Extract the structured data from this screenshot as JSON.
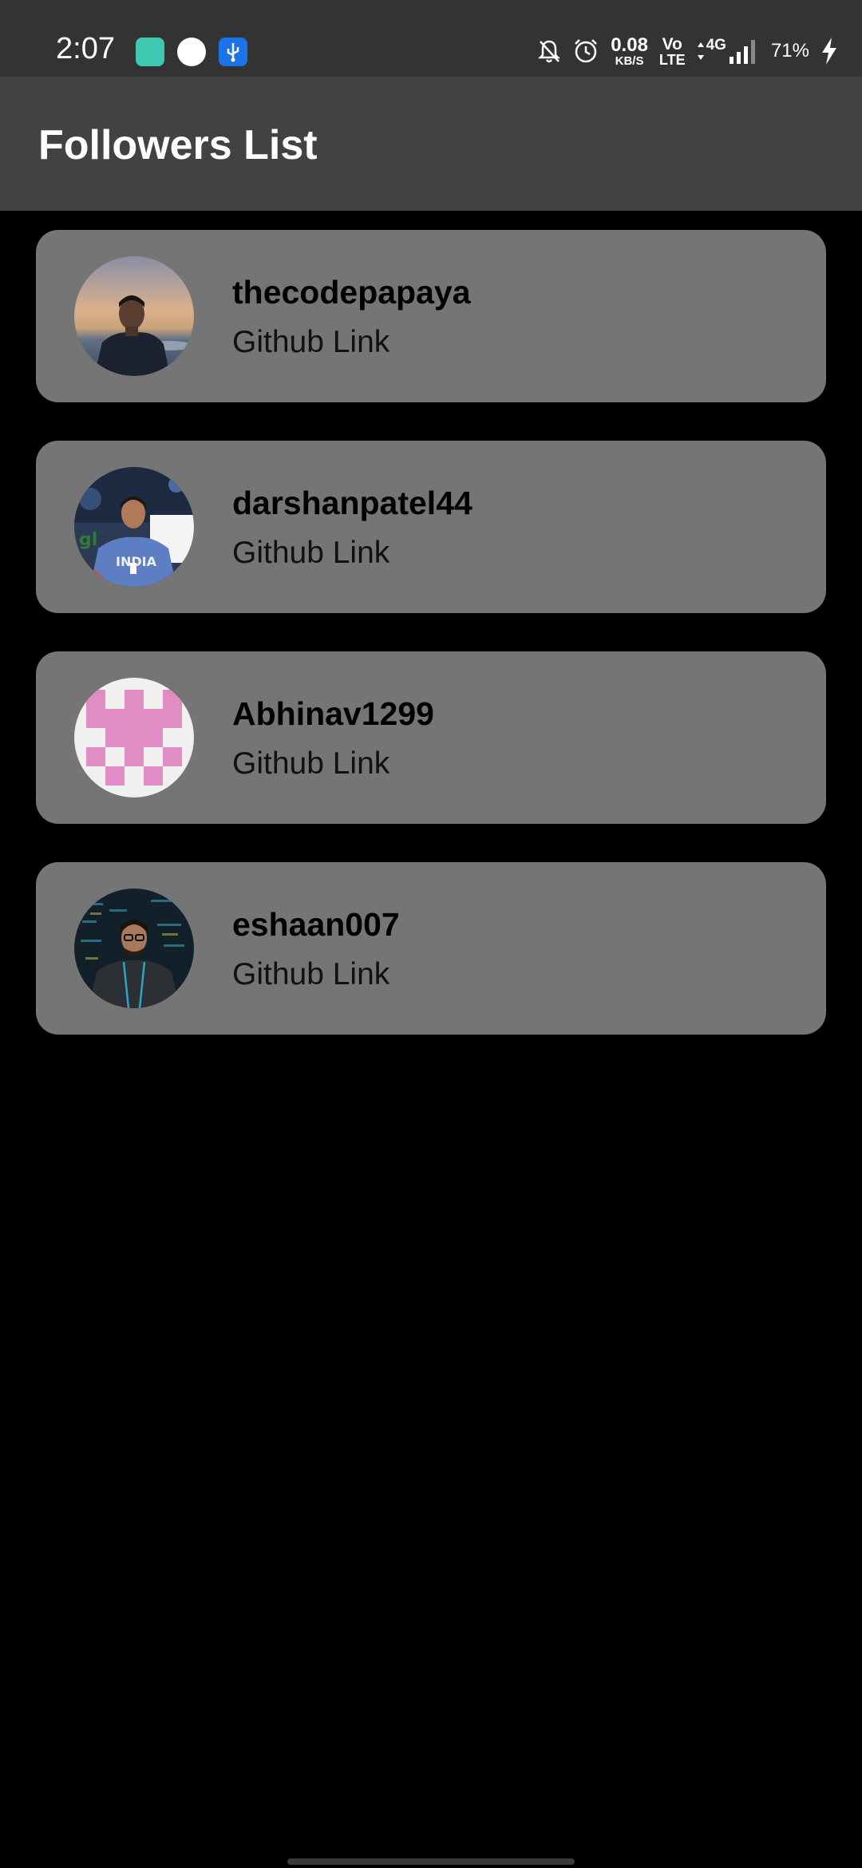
{
  "status_bar": {
    "time": "2:07",
    "net_speed_value": "0.08",
    "net_speed_unit": "KB/S",
    "volte_top": "Vo",
    "volte_bottom": "LTE",
    "network_type": "4G",
    "battery": "71%",
    "icons": [
      "notifications-off-icon",
      "alarm-icon",
      "data-arrows-icon",
      "signal-icon",
      "charging-icon"
    ]
  },
  "app_bar": {
    "title": "Followers List"
  },
  "followers": [
    {
      "username": "thecodepapaya",
      "link_label": "Github Link",
      "avatar": "photo-man-sunset"
    },
    {
      "username": "darshanpatel44",
      "link_label": "Github Link",
      "avatar": "photo-man-india-tshirt"
    },
    {
      "username": "Abhinav1299",
      "link_label": "Github Link",
      "avatar": "identicon-pink"
    },
    {
      "username": "eshaan007",
      "link_label": "Github Link",
      "avatar": "photo-man-hoodie-code"
    }
  ],
  "colors": {
    "status_bar_bg": "#333333",
    "app_bar_bg": "#424242",
    "background": "#000000",
    "card_bg": "#757575",
    "identicon_pink": "#E28CC4"
  }
}
